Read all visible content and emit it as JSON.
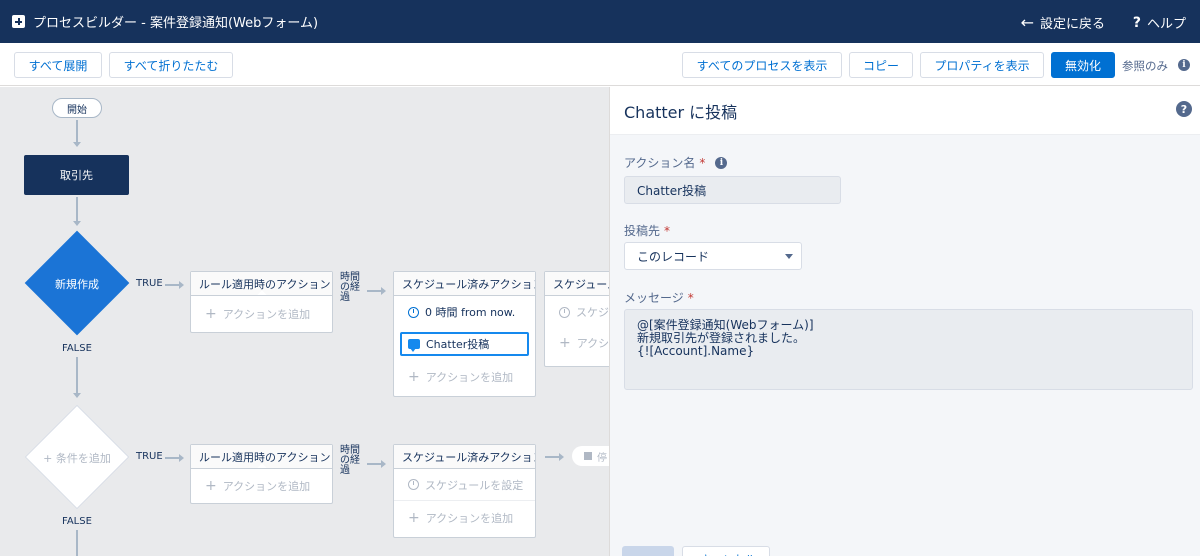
{
  "window": {
    "title": "プロセスビルダー - 案件登録通知(Webフォーム)",
    "back_label": "設定に戻る",
    "help_label": "ヘルプ"
  },
  "toolbar": {
    "expand_all": "すべて展開",
    "collapse_all": "すべて折りたたむ",
    "view_all_processes": "すべてのプロセスを表示",
    "copy": "コピー",
    "view_properties": "プロパティを表示",
    "deactivate": "無効化",
    "read_only": "参照のみ"
  },
  "canvas": {
    "start": "開始",
    "object": "取引先",
    "criteria1": "新規作成",
    "criteria2_add": "条件を追加",
    "true_label": "TRUE",
    "false_label": "FALSE",
    "time_elapsed": "時間の経過",
    "immediate_actions": "ルール適用時のアクション",
    "scheduled_actions": "スケジュール済みアクション",
    "scheduled_actions_truncated": "スケジュール",
    "add_action": "アクションを追加",
    "schedule_time": "0 時間 from now.",
    "chatter_action": "Chatter投稿",
    "set_schedule": "スケジュールを設定",
    "schedule_truncated": "スケジ",
    "add_truncated": "アクシ",
    "pending_truncated": "停"
  },
  "panel": {
    "title": "Chatter に投稿",
    "action_name_label": "アクション名",
    "action_name_value": "Chatter投稿",
    "post_to_label": "投稿先",
    "post_to_value": "このレコード",
    "message_label": "メッセージ",
    "message_value": "@[案件登録通知(Webフォーム)]\n新規取引先が登録されました。\n{![Account].Name}",
    "save_truncated": "",
    "cancel_truncated": "キャンセル"
  },
  "colors": {
    "header_bg": "#16325c",
    "brand_blue": "#0070d2",
    "criteria_blue": "#1b74d6",
    "canvas_bg": "#e9eaec",
    "required_red": "#c23934"
  }
}
